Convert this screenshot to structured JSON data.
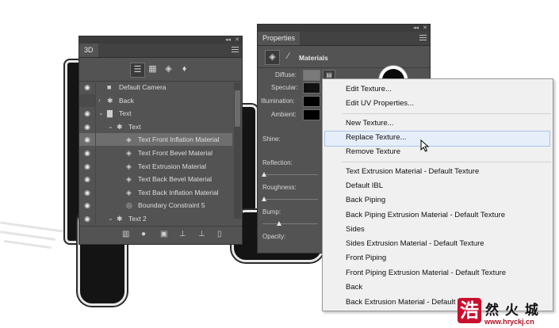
{
  "panel3d": {
    "title": "3D",
    "toolbar_icons": [
      "whole-scene-icon",
      "meshes-icon",
      "materials-icon",
      "lights-icon"
    ],
    "rows": [
      {
        "label": "Default Camera",
        "icon": "camera-icon",
        "visible": true,
        "indent": 0,
        "expand": "",
        "selected": false
      },
      {
        "label": "Back",
        "icon": "mesh-icon",
        "visible": false,
        "indent": 0,
        "expand": "›",
        "selected": false
      },
      {
        "label": "Text",
        "icon": "scene-group-icon",
        "visible": true,
        "indent": 0,
        "expand": "⌄",
        "selected": false
      },
      {
        "label": "Text",
        "icon": "mesh-icon",
        "visible": true,
        "indent": 1,
        "expand": "⌄",
        "selected": false
      },
      {
        "label": "Text Front Inflation Material",
        "icon": "material-icon",
        "visible": true,
        "indent": 2,
        "expand": "",
        "selected": true
      },
      {
        "label": "Text Front Bevel Material",
        "icon": "material-icon",
        "visible": true,
        "indent": 2,
        "expand": "",
        "selected": false
      },
      {
        "label": "Text Extrusion Material",
        "icon": "material-icon",
        "visible": true,
        "indent": 2,
        "expand": "",
        "selected": false
      },
      {
        "label": "Text Back Bevel Material",
        "icon": "material-icon",
        "visible": true,
        "indent": 2,
        "expand": "",
        "selected": false
      },
      {
        "label": "Text Back Inflation Material",
        "icon": "material-icon",
        "visible": true,
        "indent": 2,
        "expand": "",
        "selected": false
      },
      {
        "label": "Boundary Constraint 5",
        "icon": "constraint-icon",
        "visible": true,
        "indent": 2,
        "expand": "",
        "selected": false
      },
      {
        "label": "Text 2",
        "icon": "mesh-icon",
        "visible": true,
        "indent": 1,
        "expand": "⌄",
        "selected": false
      }
    ],
    "footer_icons": [
      "render-icon",
      "add-light-icon",
      "new-mesh-icon",
      "move-to-view-icon",
      "new-constraint-icon",
      "delete-icon"
    ]
  },
  "properties": {
    "title": "Properties",
    "section": "Materials",
    "fields": {
      "diffuse": "Diffuse:",
      "specular": "Specular:",
      "illumination": "Illumination:",
      "ambient": "Ambient:",
      "shine": "Shine:",
      "reflection": "Reflection:",
      "roughness": "Roughness:",
      "bump": "Bump:",
      "opacity": "Opacity:"
    },
    "colors": {
      "diffuse": "#7a7a7a",
      "specular": "#111111",
      "illumination": "#000000",
      "ambient": "#000000"
    },
    "slider_levels": {
      "reflection": 0.0,
      "roughness": 0.0,
      "bump": 0.3
    }
  },
  "context_menu": {
    "items": [
      "Edit Texture...",
      "Edit UV Properties...",
      "New Texture...",
      "Replace Texture...",
      "Remove Texture",
      "Text Extrusion Material - Default Texture",
      "Default IBL",
      "Back Piping",
      "Back Piping Extrusion Material - Default Texture",
      "Sides",
      "Sides Extrusion Material - Default Texture",
      "Front Piping",
      "Front Piping Extrusion Material - Default Texture",
      "Back",
      "Back Extrusion Material - Default Texture"
    ],
    "highlighted_index": 3
  },
  "watermark": {
    "glyph": "浩",
    "chars": "然 火 城",
    "url": "www.hryckj.cn"
  }
}
